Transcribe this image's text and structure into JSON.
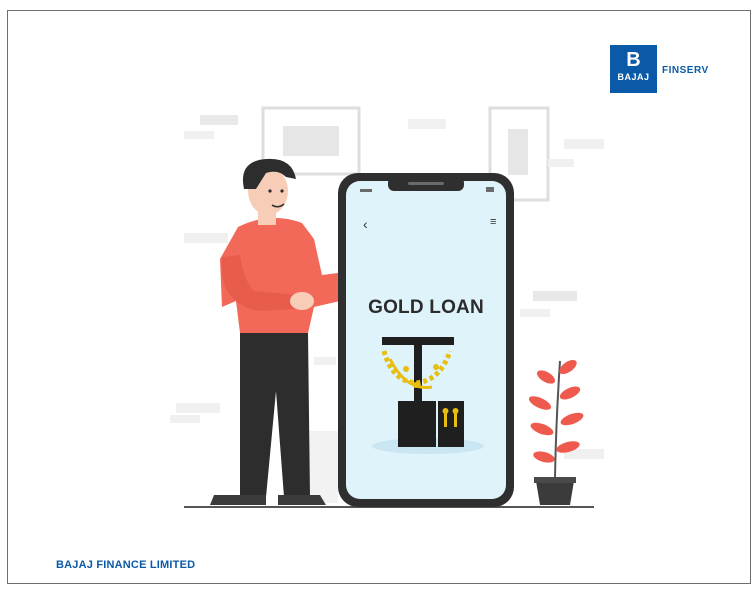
{
  "brand": {
    "logo_letter": "B",
    "logo_name": "BAJAJ",
    "logo_product": "FINSERV",
    "color": "#0a5aa8"
  },
  "phone": {
    "title": "GOLD LOAN",
    "back_icon": "chevron-left-icon",
    "menu_icon": "hamburger-menu-icon",
    "back_glyph": "‹",
    "menu_glyph": "≡"
  },
  "footer": {
    "company": "BAJAJ FINANCE LIMITED"
  },
  "colors": {
    "shirt": "#f2695a",
    "pants": "#2d2d2d",
    "skin": "#f7cdb8",
    "phone_body": "#2f2f2f",
    "phone_screen": "#dff3fb",
    "gold": "#e8be12",
    "plant": "#ef5a4f",
    "pot": "#3b3b3b"
  }
}
